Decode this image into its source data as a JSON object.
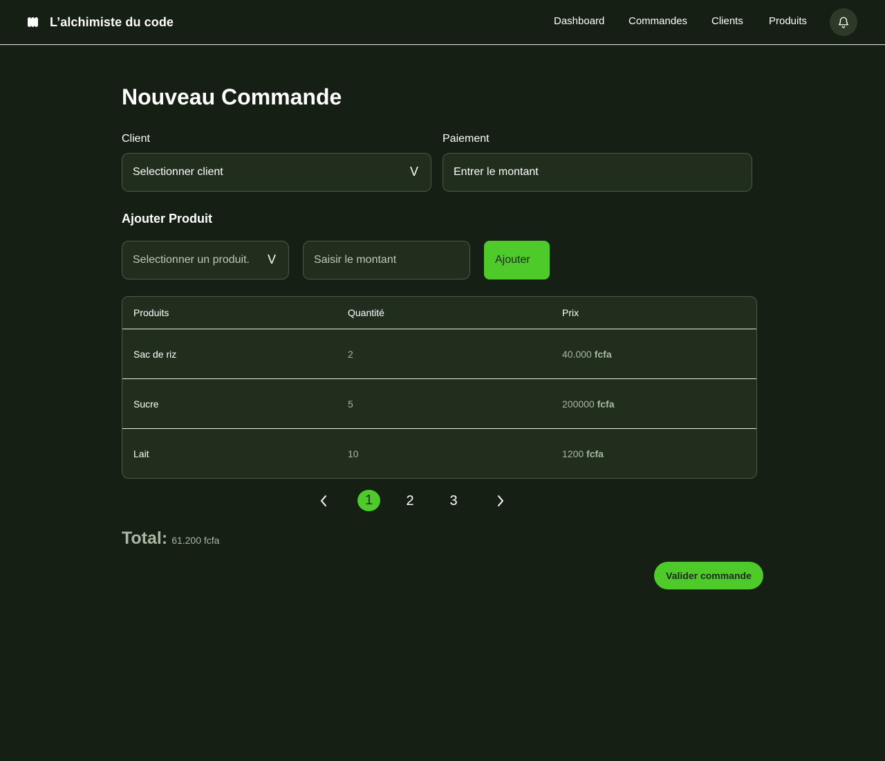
{
  "header": {
    "brand_name": "L’alchimiste du code",
    "nav": [
      "Dashboard",
      "Commandes",
      "Clients",
      "Produits"
    ]
  },
  "page": {
    "title": "Nouveau Commande"
  },
  "client": {
    "label": "Client",
    "placeholder": "Selectionner client",
    "chevron": "V"
  },
  "paiement": {
    "label": "Paiement",
    "placeholder": "Entrer le montant"
  },
  "ajouter_produit": {
    "title": "Ajouter Produit",
    "product_placeholder": "Selectionner un produit.",
    "chevron": "V",
    "amount_placeholder": "Saisir le montant",
    "button_label": "Ajouter"
  },
  "table": {
    "headers": [
      "Produits",
      "Quantité",
      "Prix"
    ],
    "rows": [
      {
        "produit": "Sac de riz",
        "quantite": "2",
        "prix": "40.000",
        "currency": "fcfa"
      },
      {
        "produit": "Sucre",
        "quantite": "5",
        "prix": "200000",
        "currency": "fcfa"
      },
      {
        "produit": "Lait",
        "quantite": "10",
        "prix": "1200",
        "currency": "fcfa"
      }
    ]
  },
  "pagination": {
    "prev_glyph": "‹",
    "next_glyph": "›",
    "pages": [
      "1",
      "2",
      "3"
    ],
    "current": "1"
  },
  "total": {
    "label": "Total:",
    "value": "61.200 fcfa"
  },
  "valider_label": "Valider commande",
  "colors": {
    "background": "#161f13",
    "surface": "#212e1e",
    "accent": "#4ecb2b",
    "muted_text": "#a8b8a3"
  },
  "icons": [
    "logo-icon",
    "bell-icon",
    "chevron-down-icon",
    "chevron-left-icon",
    "chevron-right-icon"
  ]
}
